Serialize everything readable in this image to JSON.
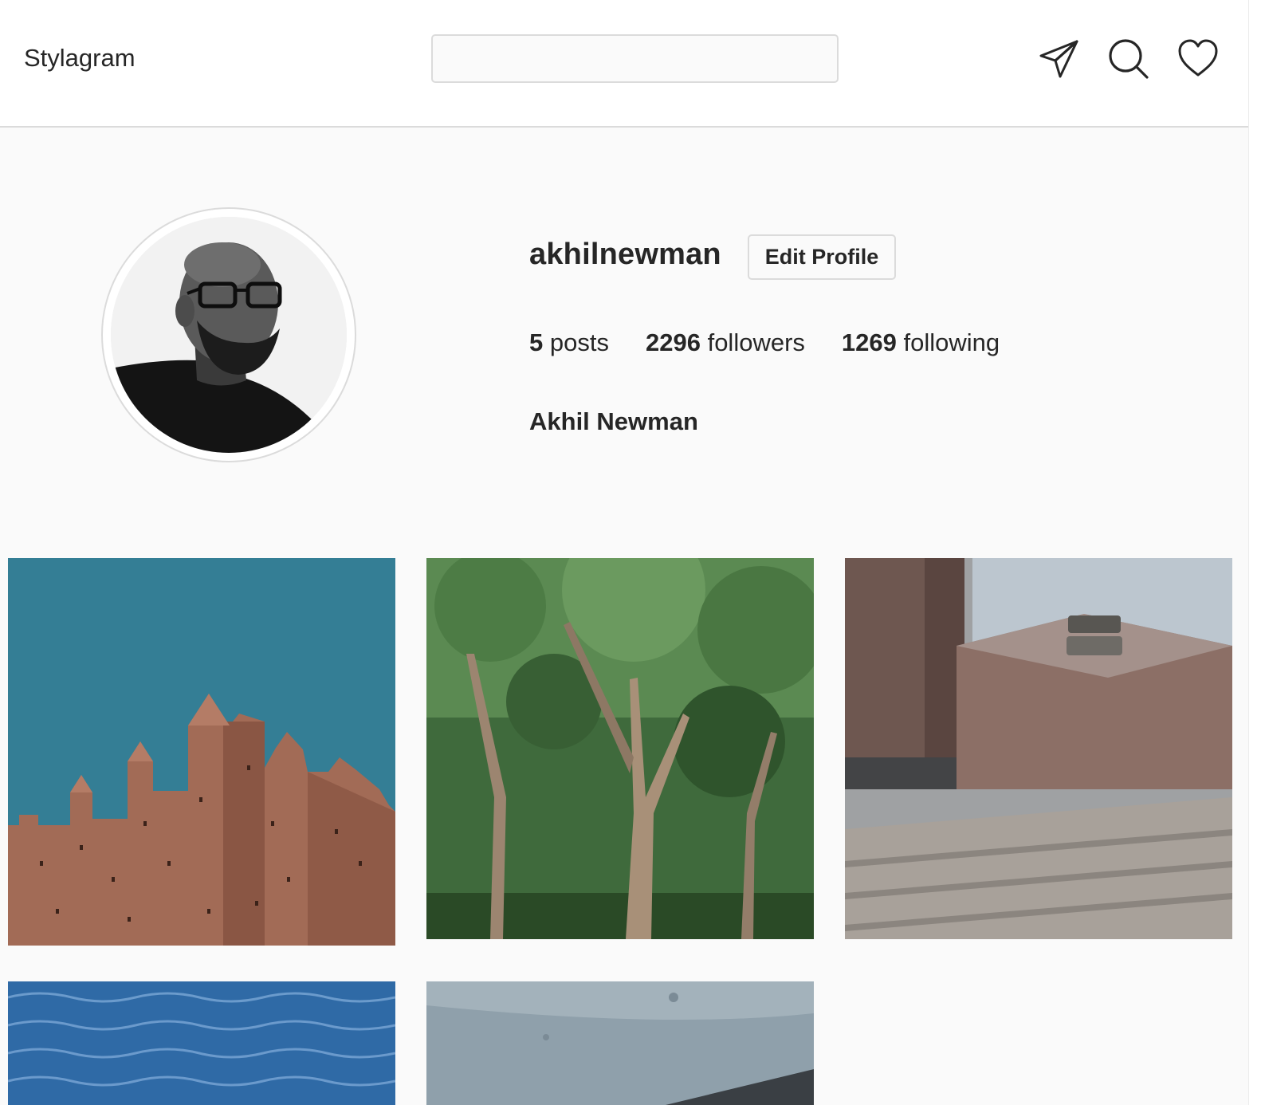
{
  "header": {
    "brand": "Stylagram",
    "search_placeholder": "",
    "icons": [
      "send-icon",
      "search-icon",
      "heart-icon"
    ]
  },
  "profile": {
    "username": "akhilnewman",
    "edit_button_label": "Edit Profile",
    "stats": {
      "posts_count": "5",
      "posts_label": "posts",
      "followers_count": "2296",
      "followers_label": "followers",
      "following_count": "1269",
      "following_label": "following"
    },
    "full_name": "Akhil Newman",
    "avatar_style": "black-and-white portrait"
  },
  "posts": [
    {
      "subject": "terracotta fortress wall against teal sky",
      "colors": [
        "#347e95",
        "#a26b56"
      ]
    },
    {
      "subject": "trees in a green park",
      "colors": [
        "#3f6a3c",
        "#9c8570"
      ]
    },
    {
      "subject": "granite block and stone steps",
      "colors": [
        "#8c6f66",
        "#a8a19a"
      ]
    },
    {
      "subject": "blue water surface",
      "colors": [
        "#2f6aa6",
        "#7aa7d6"
      ]
    },
    {
      "subject": "grey concrete surface",
      "colors": [
        "#8fa0ab",
        "#6d7d88"
      ]
    }
  ],
  "colors": {
    "background": "#fafafa",
    "border": "#dbdbdb",
    "text": "#262626"
  }
}
